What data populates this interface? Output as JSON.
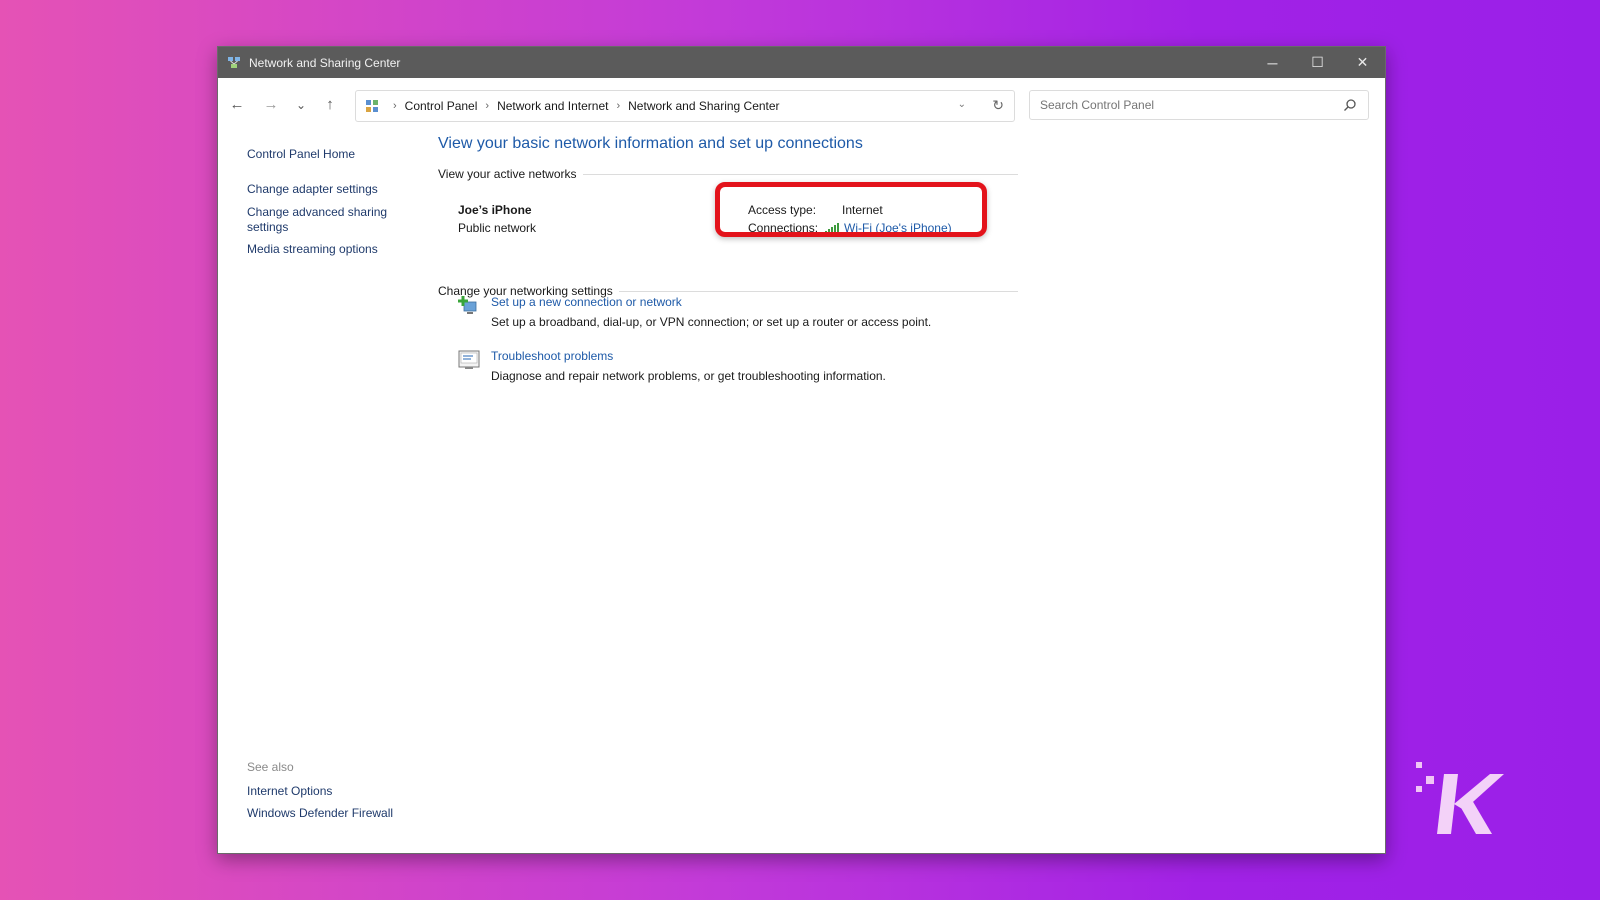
{
  "window": {
    "title": "Network and Sharing Center",
    "controls": {
      "minimize": "─",
      "maximize": "☐",
      "close": "✕"
    }
  },
  "nav": {
    "back": "←",
    "forward": "→",
    "recent": "⌄",
    "up": "↑"
  },
  "breadcrumb": {
    "items": [
      "Control Panel",
      "Network and Internet",
      "Network and Sharing Center"
    ],
    "separator": "›"
  },
  "search": {
    "placeholder": "Search Control Panel",
    "value": ""
  },
  "sidebar": {
    "items": [
      {
        "label": "Control Panel Home"
      },
      {
        "label": "Change adapter settings"
      },
      {
        "label": "Change advanced sharing settings"
      },
      {
        "label": "Media streaming options"
      }
    ],
    "see_also": {
      "heading": "See also",
      "items": [
        {
          "label": "Internet Options"
        },
        {
          "label": "Windows Defender Firewall"
        }
      ]
    }
  },
  "main": {
    "heading": "View your basic network information and set up connections",
    "active_networks_heading": "View your active networks",
    "network": {
      "name": "Joe’s iPhone",
      "type": "Public network",
      "access_type_label": "Access type:",
      "access_type_value": "Internet",
      "connections_label": "Connections:",
      "connections_value": "Wi-Fi (Joe's iPhone)"
    },
    "change_settings_heading": "Change your networking settings",
    "tasks": [
      {
        "title": "Set up a new connection or network",
        "description": "Set up a broadband, dial-up, or VPN connection; or set up a router or access point."
      },
      {
        "title": "Troubleshoot problems",
        "description": "Diagnose and repair network problems, or get troubleshooting information."
      }
    ]
  },
  "colors": {
    "link": "#1e5aa8",
    "highlight": "#e3131b",
    "titlebar": "#5b5b5b"
  },
  "icons": {
    "app": "network-center-icon",
    "search": "search-icon",
    "wifi": "wifi-signal-icon",
    "new_connection": "new-connection-icon",
    "troubleshoot": "troubleshoot-icon",
    "watermark": "knowtechie-logo"
  }
}
